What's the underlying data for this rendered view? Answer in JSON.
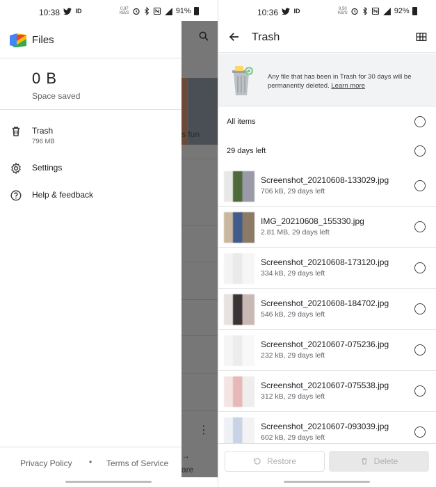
{
  "left": {
    "status": {
      "time": "10:38",
      "net_top": "0.87",
      "net_bottom": "KB/S",
      "battery": "91%"
    },
    "drawer": {
      "app_title": "Files",
      "space_value": "0 B",
      "space_label": "Space saved",
      "items": [
        {
          "label": "Trash",
          "sub": "796 MB",
          "icon": "trash-icon"
        },
        {
          "label": "Settings",
          "icon": "gear-icon"
        },
        {
          "label": "Help & feedback",
          "icon": "help-icon"
        }
      ],
      "footer": {
        "privacy": "Privacy Policy",
        "dot": "•",
        "terms": "Terms of Service"
      }
    },
    "background": {
      "snippet": "s fun",
      "share_a": "→",
      "share_b": "are"
    }
  },
  "right": {
    "status": {
      "time": "10:36",
      "net_top": "9.50",
      "net_bottom": "KB/S",
      "battery": "92%"
    },
    "topbar": {
      "title": "Trash"
    },
    "banner": {
      "message": "Any file that has been in Trash for 30 days will be permanently deleted.",
      "link": "Learn more"
    },
    "sections": {
      "all_items": "All items",
      "group": "29 days left"
    },
    "files": [
      {
        "name": "Screenshot_20210608-133029.jpg",
        "meta": "706 kB, 29 days left",
        "thumb": [
          "#e8e8e8",
          "#4f6a3a",
          "#9a9aa8"
        ]
      },
      {
        "name": "IMG_20210608_155330.jpg",
        "meta": "2.81 MB, 29 days left",
        "thumb": [
          "#c9b8a0",
          "#3f5c8a",
          "#8a7a66"
        ]
      },
      {
        "name": "Screenshot_20210608-173120.jpg",
        "meta": "334 kB, 29 days left",
        "thumb": [
          "#f3f3f3",
          "#eaeaea",
          "#f6f6f6"
        ]
      },
      {
        "name": "Screenshot_20210608-184702.jpg",
        "meta": "546 kB, 29 days left",
        "thumb": [
          "#e6e2e0",
          "#3a3436",
          "#c9b9b4"
        ]
      },
      {
        "name": "Screenshot_20210607-075236.jpg",
        "meta": "232 kB, 29 days left",
        "thumb": [
          "#f5f5f5",
          "#ececec",
          "#f8f8f8"
        ]
      },
      {
        "name": "Screenshot_20210607-075538.jpg",
        "meta": "312 kB, 29 days left",
        "thumb": [
          "#f4e4e4",
          "#e6b8b8",
          "#eeeeee"
        ]
      },
      {
        "name": "Screenshot_20210607-093039.jpg",
        "meta": "602 kB, 29 days left",
        "thumb": [
          "#eef2f6",
          "#c8d4e6",
          "#f3f3f3"
        ]
      }
    ],
    "actions": {
      "restore": "Restore",
      "delete": "Delete"
    }
  },
  "colors": {
    "text": "#202124",
    "secondary": "#5f6368",
    "banner_bg": "#f1f3f4",
    "dim": "#777777",
    "disabled": "#b0b0b0"
  }
}
